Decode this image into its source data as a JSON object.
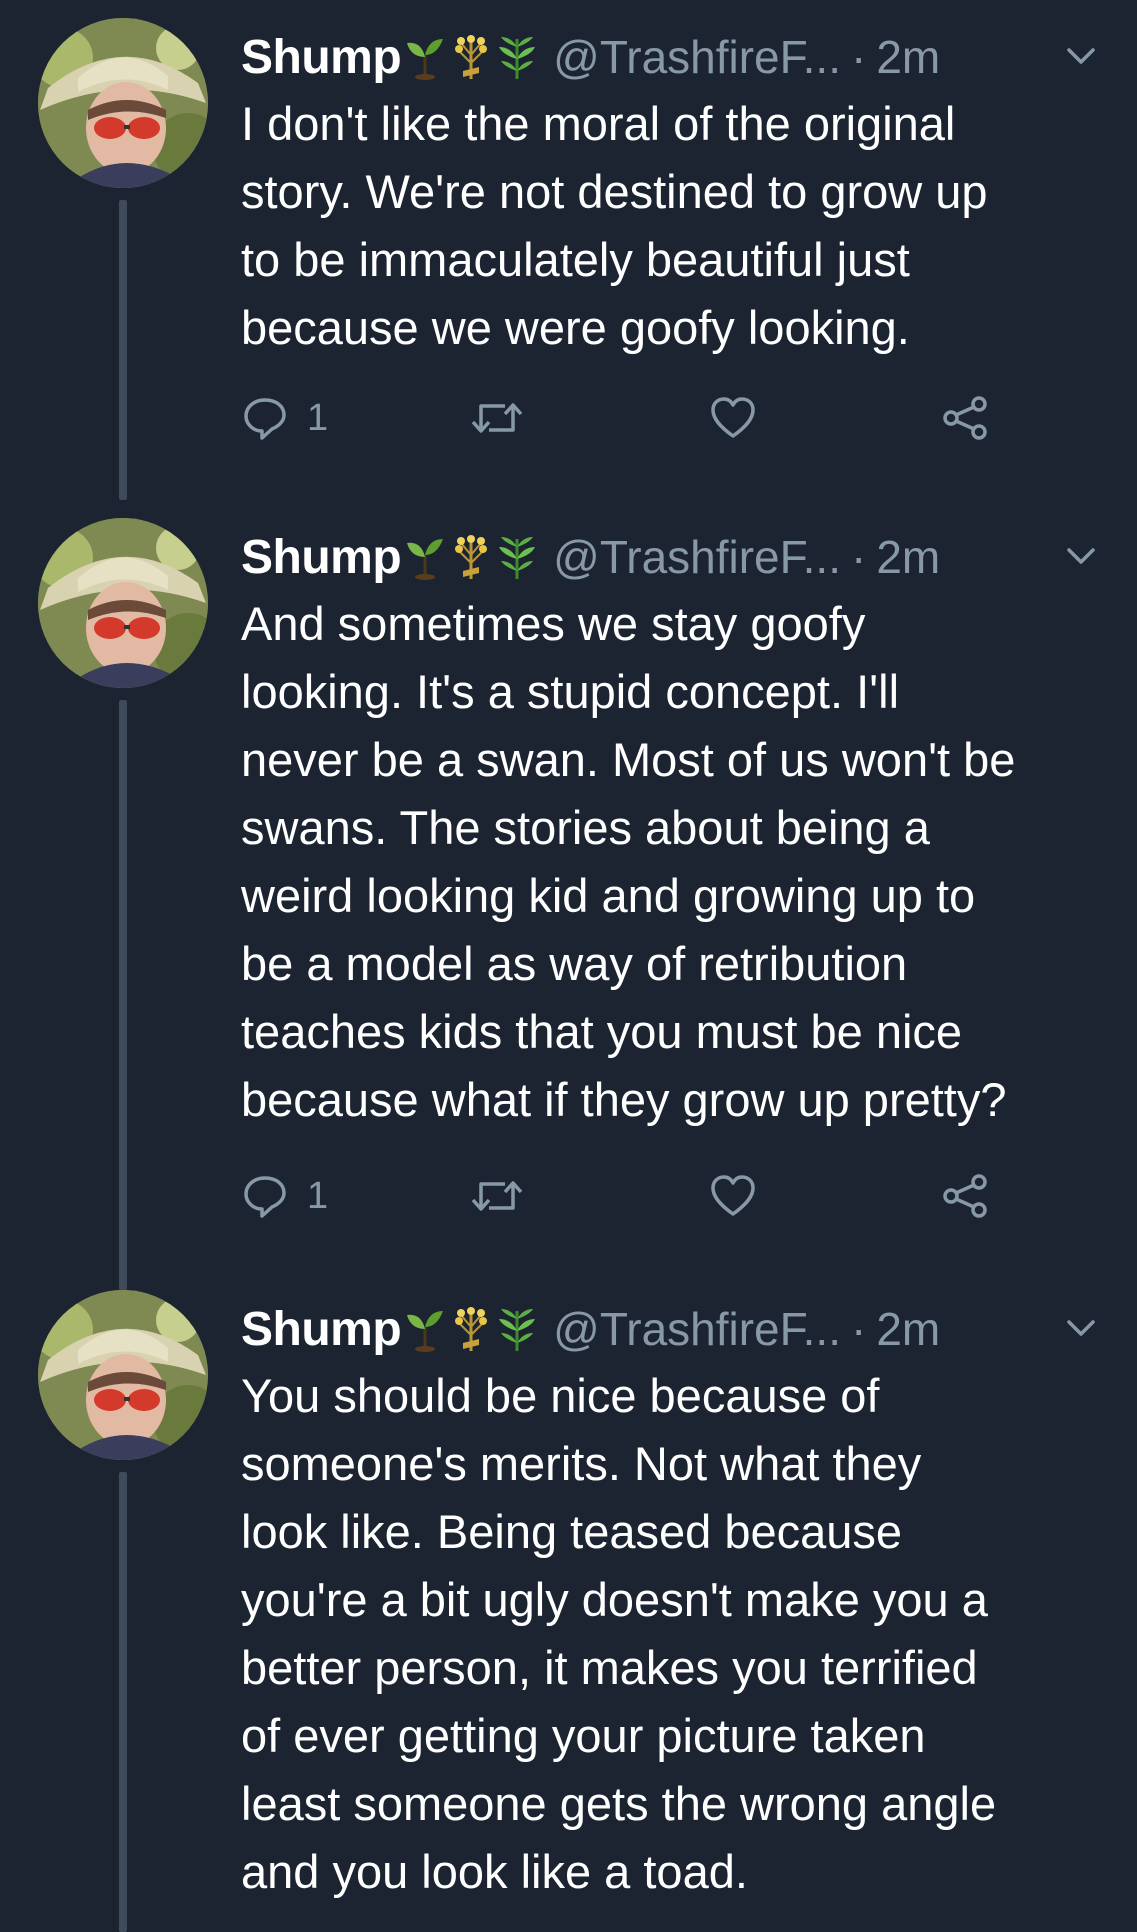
{
  "colors": {
    "background": "#1c2431",
    "text": "#ffffff",
    "secondary": "#8899a6",
    "thread_line": "#3f4b5b"
  },
  "tweets": [
    {
      "display_name": "Shump",
      "name_emojis": [
        "seedling-emoji",
        "sheaf-of-rice-emoji",
        "herb-emoji"
      ],
      "handle": "@TrashfireF...",
      "separator": "·",
      "time": "2m",
      "text_lines": [
        "I don't like the moral of the original",
        "story. We're not destined to grow up",
        "to be immaculately beautiful just",
        "because we were goofy looking."
      ],
      "reply_count": "1"
    },
    {
      "display_name": "Shump",
      "name_emojis": [
        "seedling-emoji",
        "sheaf-of-rice-emoji",
        "herb-emoji"
      ],
      "handle": "@TrashfireF...",
      "separator": "·",
      "time": "2m",
      "text_lines": [
        "And sometimes we stay goofy",
        "looking. It's a stupid concept. I'll",
        "never be a swan. Most of us won't be",
        "swans. The stories about being a",
        "weird looking kid and growing up to",
        "be a model as way of retribution",
        "teaches kids that you must be nice",
        "because what if they grow up pretty?"
      ],
      "reply_count": "1"
    },
    {
      "display_name": "Shump",
      "name_emojis": [
        "seedling-emoji",
        "sheaf-of-rice-emoji",
        "herb-emoji"
      ],
      "handle": "@TrashfireF...",
      "separator": "·",
      "time": "2m",
      "text_lines": [
        "You should be nice because of",
        "someone's merits. Not what they",
        "look like. Being teased because",
        "you're a bit ugly doesn't make you a",
        "better person, it makes you terrified",
        "of ever getting your picture taken",
        "least someone gets the wrong angle",
        "and you look like a toad."
      ]
    }
  ]
}
